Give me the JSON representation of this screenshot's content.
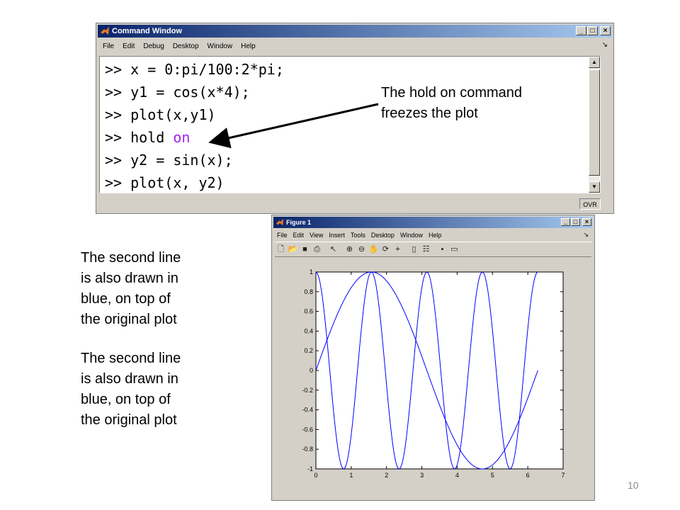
{
  "command_window": {
    "title": "Command Window",
    "menu": [
      "File",
      "Edit",
      "Debug",
      "Desktop",
      "Window",
      "Help"
    ],
    "lines": [
      {
        "prompt": ">>",
        "code": " x = 0:pi/100:2*pi;",
        "keyword": ""
      },
      {
        "prompt": ">>",
        "code": " y1 = cos(x*4);",
        "keyword": ""
      },
      {
        "prompt": ">>",
        "code": " plot(x,y1)",
        "keyword": ""
      },
      {
        "prompt": ">>",
        "code": " hold ",
        "keyword": "on"
      },
      {
        "prompt": ">>",
        "code": " y2 = sin(x);",
        "keyword": ""
      },
      {
        "prompt": ">>",
        "code": " plot(x, y2)",
        "keyword": ""
      }
    ],
    "status": "OVR",
    "keyword_color": "#a020f0"
  },
  "annotations": {
    "hold_note": [
      "The hold on command",
      "freezes the plot"
    ],
    "second_line_note_1": [
      "The second line",
      "is also drawn in",
      "blue, on top of",
      "the original plot"
    ],
    "second_line_note_2": [
      "The second line",
      "is also drawn in",
      "blue, on top of",
      "the original plot"
    ]
  },
  "figure_window": {
    "title": "Figure 1",
    "menu": [
      "File",
      "Edit",
      "View",
      "Insert",
      "Tools",
      "Desktop",
      "Window",
      "Help"
    ],
    "toolbar_icons": [
      "new-file-icon",
      "open-folder-icon",
      "save-icon",
      "print-icon",
      "pointer-icon",
      "zoom-in-icon",
      "zoom-out-icon",
      "pan-icon",
      "rotate-icon",
      "data-cursor-icon",
      "colorbar-icon",
      "legend-icon",
      "hide-plot-tools-icon",
      "show-plot-tools-icon"
    ]
  },
  "chart_data": {
    "type": "line",
    "line_color": "#0000ff",
    "xlim": [
      0,
      7
    ],
    "ylim": [
      -1,
      1
    ],
    "x_ticks": [
      "0",
      "1",
      "2",
      "3",
      "4",
      "5",
      "6",
      "7"
    ],
    "y_ticks": [
      "-1",
      "-0.8",
      "-0.6",
      "-0.4",
      "-0.2",
      "0",
      "0.2",
      "0.4",
      "0.6",
      "0.8",
      "1"
    ],
    "x_range": [
      0,
      6.2832
    ],
    "series": [
      {
        "function": "cos(x*4)"
      },
      {
        "function": "sin(x)"
      }
    ]
  },
  "page_number": "10"
}
